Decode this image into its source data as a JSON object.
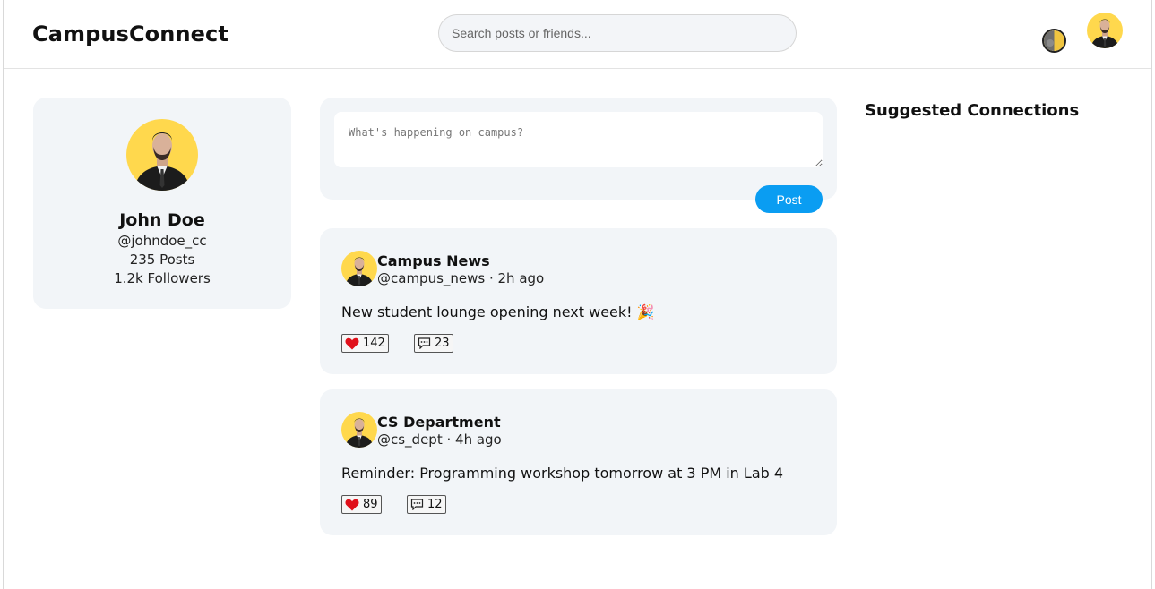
{
  "header": {
    "brand": "CampusConnect",
    "search_placeholder": "Search posts or friends...",
    "theme_toggle_icon": "half-moon-icon",
    "user_avatar_icon": "user-avatar"
  },
  "profile": {
    "name": "John Doe",
    "handle": "@johndoe_cc",
    "posts": "235 Posts",
    "followers": "1.2k Followers"
  },
  "composer": {
    "placeholder": "What's happening on campus?",
    "post_label": "Post"
  },
  "posts": [
    {
      "author": "Campus News",
      "meta": "@campus_news · 2h ago",
      "body": "New student lounge opening next week! 🎉",
      "likes": "142",
      "comments": "23"
    },
    {
      "author": "CS Department",
      "meta": "@cs_dept · 4h ago",
      "body": "Reminder: Programming workshop tomorrow at 3 PM in Lab 4",
      "likes": "89",
      "comments": "12"
    }
  ],
  "sidebar": {
    "suggested_title": "Suggested Connections"
  },
  "colors": {
    "accent": "#0a9df2",
    "card_bg": "#f2f5f8",
    "avatar_bg": "#ffd84d",
    "heart": "#e0101a"
  }
}
